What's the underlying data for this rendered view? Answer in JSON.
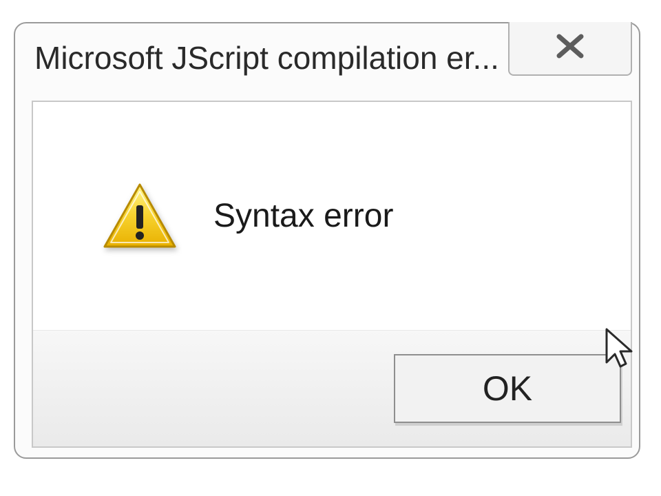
{
  "dialog": {
    "title": "Microsoft JScript compilation er...",
    "close_label": "✖",
    "message": "Syntax error",
    "ok_label": "OK",
    "icon": "warning-icon"
  }
}
